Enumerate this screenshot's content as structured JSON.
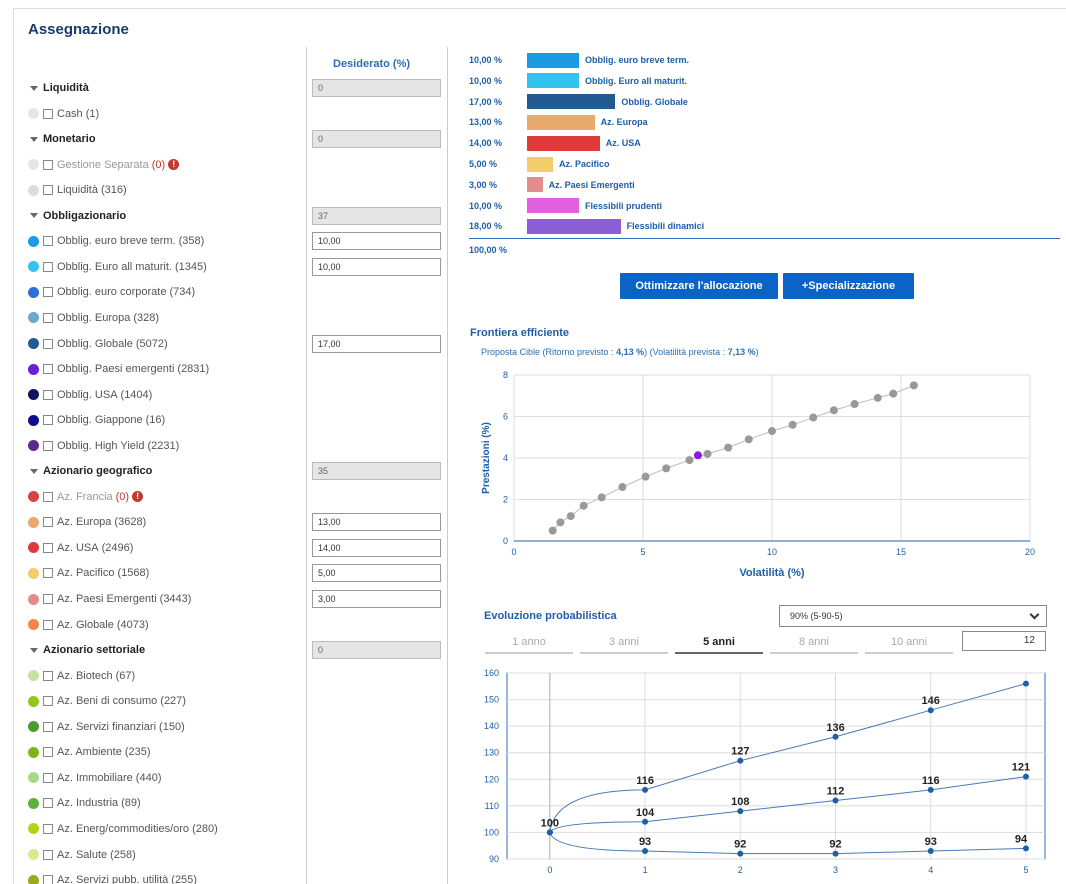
{
  "title": "Assegnazione",
  "desired_header": "Desiderato (%)",
  "groups": [
    {
      "label": "Liquidità",
      "value": "0"
    },
    {
      "label": "Monetario",
      "value": "0"
    },
    {
      "label": "Obbligazionario",
      "value": "37"
    },
    {
      "label": "Azionario geografico",
      "value": "35"
    },
    {
      "label": "Azionario settoriale",
      "value": "0"
    }
  ],
  "items": [
    {
      "label": "Cash",
      "count": "(1)",
      "color": "#e6e6e6",
      "value": ""
    },
    {
      "label": "Gestione Separata",
      "count": "(0)",
      "color": "#e6e6e6",
      "value": "",
      "warn": "!"
    },
    {
      "label": "Liquidità",
      "count": "(316)",
      "color": "#dddddd",
      "value": ""
    },
    {
      "label": "Obblig. euro breve term.",
      "count": "(358)",
      "color": "#1b9be3",
      "value": "10,00"
    },
    {
      "label": "Obblig. Euro all maturit.",
      "count": "(1345)",
      "color": "#33c3f0",
      "value": "10,00"
    },
    {
      "label": "Obblig. euro corporate",
      "count": "(734)",
      "color": "#2f6fd6",
      "value": ""
    },
    {
      "label": "Obblig. Europa",
      "count": "(328)",
      "color": "#6aa8d0",
      "value": ""
    },
    {
      "label": "Obblig. Globale",
      "count": "(5072)",
      "color": "#235a92",
      "value": "17,00"
    },
    {
      "label": "Obblig. Paesi emergenti",
      "count": "(2831)",
      "color": "#6a1fd6",
      "value": ""
    },
    {
      "label": "Obblig. USA",
      "count": "(1404)",
      "color": "#13125e",
      "value": ""
    },
    {
      "label": "Obblig. Giappone",
      "count": "(16)",
      "color": "#0c0f8a",
      "value": ""
    },
    {
      "label": "Obblig. High Yield",
      "count": "(2231)",
      "color": "#5a2b8f",
      "value": ""
    },
    {
      "label": "Az. Francia",
      "count": "(0)",
      "color": "#d64545",
      "value": "",
      "warn": "!"
    },
    {
      "label": "Az. Europa",
      "count": "(3628)",
      "color": "#e8a96a",
      "value": "13,00"
    },
    {
      "label": "Az. USA",
      "count": "(2496)",
      "color": "#e03b3b",
      "value": "14,00"
    },
    {
      "label": "Az. Pacifico",
      "count": "(1568)",
      "color": "#f3cd6a",
      "value": "5,00"
    },
    {
      "label": "Az. Paesi Emergenti",
      "count": "(3443)",
      "color": "#e28d8d",
      "value": "3,00"
    },
    {
      "label": "Az. Globale",
      "count": "(4073)",
      "color": "#f5854a",
      "value": ""
    },
    {
      "label": "Az. Biotech",
      "count": "(67)",
      "color": "#c8e0a0",
      "value": ""
    },
    {
      "label": "Az. Beni di consumo",
      "count": "(227)",
      "color": "#8ec81a",
      "value": ""
    },
    {
      "label": "Az. Servizi finanziari",
      "count": "(150)",
      "color": "#4e9a2a",
      "value": ""
    },
    {
      "label": "Az. Ambiente",
      "count": "(235)",
      "color": "#7cb518",
      "value": ""
    },
    {
      "label": "Az. Immobiliare",
      "count": "(440)",
      "color": "#a8d98a",
      "value": ""
    },
    {
      "label": "Az. Industria",
      "count": "(89)",
      "color": "#5bb33a",
      "value": ""
    },
    {
      "label": "Az. Energ/commodities/oro",
      "count": "(280)",
      "color": "#b5d11a",
      "value": ""
    },
    {
      "label": "Az. Salute",
      "count": "(258)",
      "color": "#dbe88e",
      "value": ""
    },
    {
      "label": "Az. Servizi pubb. utilità",
      "count": "(255)",
      "color": "#9aaa1a",
      "value": ""
    }
  ],
  "allocation": [
    {
      "pct": "10,00 %",
      "label": "Obblig. euro breve term.",
      "value": 10,
      "color": "#1b9be3"
    },
    {
      "pct": "10,00 %",
      "label": "Obblig. Euro all maturit.",
      "value": 10,
      "color": "#33c3f0"
    },
    {
      "pct": "17,00 %",
      "label": "Obblig. Globale",
      "value": 17,
      "color": "#235a92"
    },
    {
      "pct": "13,00 %",
      "label": "Az. Europa",
      "value": 13,
      "color": "#e8a96a"
    },
    {
      "pct": "14,00 %",
      "label": "Az. USA",
      "value": 14,
      "color": "#e03b3b"
    },
    {
      "pct": "5,00 %",
      "label": "Az. Pacifico",
      "value": 5,
      "color": "#f3cd6a"
    },
    {
      "pct": "3,00 %",
      "label": "Az. Paesi Emergenti",
      "value": 3,
      "color": "#e28d8d"
    },
    {
      "pct": "10,00 %",
      "label": "Flessibili prudenti",
      "value": 10,
      "color": "#e060e0"
    },
    {
      "pct": "18,00 %",
      "label": "Flessibili dinamici",
      "value": 18,
      "color": "#8a5fd6"
    }
  ],
  "allocation_total": "100,00 %",
  "buttons": {
    "optimize": "Ottimizzare l'allocazione",
    "specialize": "+Specializzazione"
  },
  "frontier": {
    "title": "Frontiera efficiente",
    "subtitle_prefix": "Proposta Cible (Ritorno previsto : ",
    "return": "4,13 %",
    "subtitle_mid": ") (Volatilità prevista : ",
    "volatility": "7,13 %",
    "subtitle_suffix": ")"
  },
  "evolution": {
    "title": "Evoluzione probabilistica",
    "select_value": "90% (5-90-5)",
    "tabs": [
      "1 anno",
      "3 anni",
      "5 anni",
      "8 anni",
      "10 anni"
    ],
    "active_tab": "5 anni",
    "custom_years": "12"
  },
  "chart_data": [
    {
      "type": "scatter",
      "title": "",
      "xlabel": "Volatilità (%)",
      "ylabel": "Prestazioni (%)",
      "xlim": [
        0,
        20
      ],
      "ylim": [
        0,
        8
      ],
      "xticks": [
        0,
        5,
        10,
        15,
        20
      ],
      "yticks": [
        0,
        2,
        4,
        6,
        8
      ],
      "grid": true,
      "series": [
        {
          "color": "#999999",
          "points": [
            [
              1.5,
              0.5
            ],
            [
              1.8,
              0.9
            ],
            [
              2.2,
              1.2
            ],
            [
              2.7,
              1.7
            ],
            [
              3.4,
              2.1
            ],
            [
              4.2,
              2.6
            ],
            [
              5.1,
              3.1
            ],
            [
              5.9,
              3.5
            ],
            [
              6.8,
              3.9
            ],
            [
              7.5,
              4.2
            ],
            [
              8.3,
              4.5
            ],
            [
              9.1,
              4.9
            ],
            [
              10.0,
              5.3
            ],
            [
              10.8,
              5.6
            ],
            [
              11.6,
              5.95
            ],
            [
              12.4,
              6.3
            ],
            [
              13.2,
              6.6
            ],
            [
              14.1,
              6.9
            ],
            [
              14.7,
              7.1
            ],
            [
              15.5,
              7.5
            ]
          ]
        },
        {
          "color": "#8a1be0",
          "points": [
            [
              7.13,
              4.13
            ]
          ]
        }
      ]
    },
    {
      "type": "line",
      "title": "",
      "xlabel": "",
      "ylabel": "",
      "x": [
        0,
        1,
        2,
        3,
        4,
        5
      ],
      "xlim": [
        -0.45,
        5.2
      ],
      "ylim": [
        90,
        160
      ],
      "yticks": [
        90,
        100,
        110,
        120,
        130,
        140,
        150,
        160
      ],
      "grid": true,
      "series": [
        {
          "values": [
            100,
            116,
            127,
            136,
            146,
            156
          ],
          "labels": [
            "100",
            "116",
            "127",
            "136",
            "146",
            ""
          ]
        },
        {
          "values": [
            100,
            104,
            108,
            112,
            116,
            121
          ],
          "labels": [
            "",
            "104",
            "108",
            "112",
            "116",
            "121"
          ]
        },
        {
          "values": [
            100,
            93,
            92,
            92,
            93,
            94
          ],
          "labels": [
            "",
            "93",
            "92",
            "92",
            "93",
            "94"
          ]
        }
      ]
    }
  ]
}
